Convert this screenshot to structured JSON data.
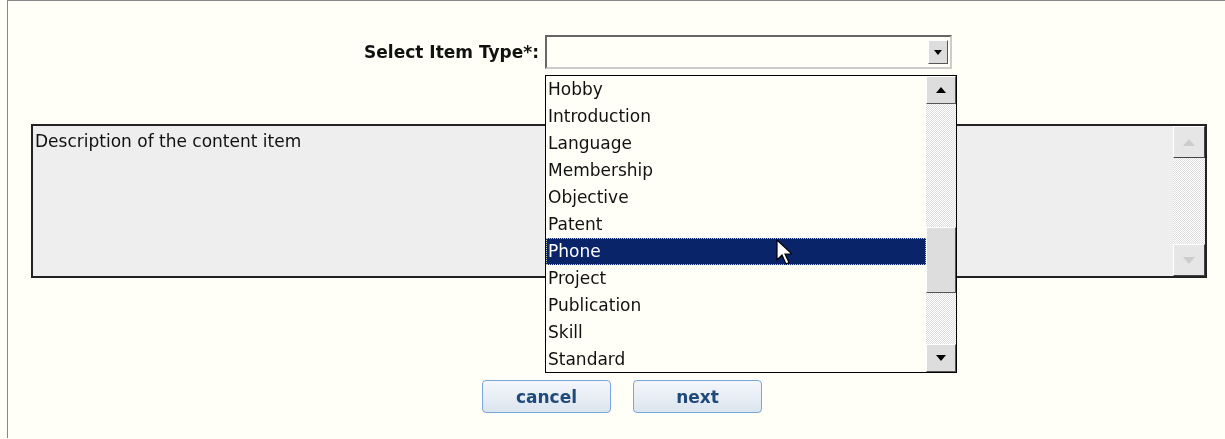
{
  "form": {
    "label": "Select Item Type*:",
    "select": {
      "expanded": true
    },
    "options": [
      {
        "label": "Hobby",
        "selected": false
      },
      {
        "label": "Introduction",
        "selected": false
      },
      {
        "label": "Language",
        "selected": false
      },
      {
        "label": "Membership",
        "selected": false
      },
      {
        "label": "Objective",
        "selected": false
      },
      {
        "label": "Patent",
        "selected": false
      },
      {
        "label": "Phone",
        "selected": true
      },
      {
        "label": "Project",
        "selected": false
      },
      {
        "label": "Publication",
        "selected": false
      },
      {
        "label": "Skill",
        "selected": false
      },
      {
        "label": "Standard",
        "selected": false
      }
    ],
    "description": {
      "value": "Description of the content item"
    },
    "buttons": [
      "cancel",
      "next"
    ]
  }
}
